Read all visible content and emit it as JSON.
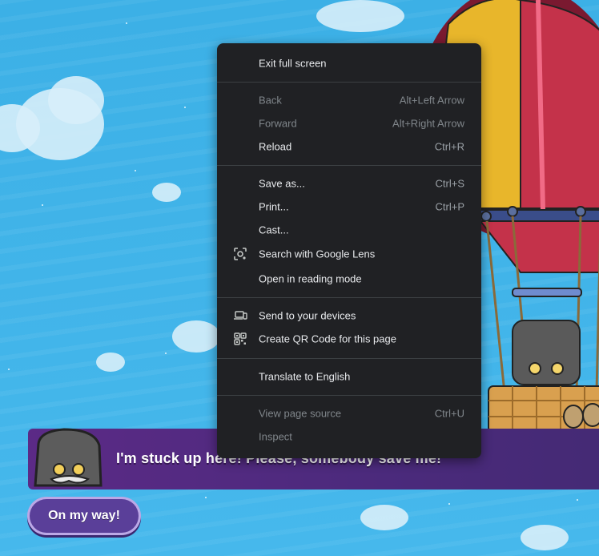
{
  "game": {
    "dialog_text": "I'm stuck up here! Please, somebody save me!",
    "cta_label": "On my way!"
  },
  "context_menu": {
    "items": [
      {
        "label": "Exit full screen",
        "shortcut": "",
        "enabled": true
      },
      {
        "label": "Back",
        "shortcut": "Alt+Left Arrow",
        "enabled": false
      },
      {
        "label": "Forward",
        "shortcut": "Alt+Right Arrow",
        "enabled": false
      },
      {
        "label": "Reload",
        "shortcut": "Ctrl+R",
        "enabled": true
      },
      {
        "label": "Save as...",
        "shortcut": "Ctrl+S",
        "enabled": true
      },
      {
        "label": "Print...",
        "shortcut": "Ctrl+P",
        "enabled": true
      },
      {
        "label": "Cast...",
        "shortcut": "",
        "enabled": true
      },
      {
        "label": "Search with Google Lens",
        "shortcut": "",
        "enabled": true,
        "icon": "google-lens-icon"
      },
      {
        "label": "Open in reading mode",
        "shortcut": "",
        "enabled": true
      },
      {
        "label": "Send to your devices",
        "shortcut": "",
        "enabled": true,
        "icon": "devices-icon"
      },
      {
        "label": "Create QR Code for this page",
        "shortcut": "",
        "enabled": true,
        "icon": "qr-code-icon"
      },
      {
        "label": "Translate to English",
        "shortcut": "",
        "enabled": true
      },
      {
        "label": "View page source",
        "shortcut": "Ctrl+U",
        "enabled": false
      },
      {
        "label": "Inspect",
        "shortcut": "",
        "enabled": false
      }
    ]
  },
  "colors": {
    "menu_bg": "#202124",
    "menu_text": "#e8eaed",
    "menu_disabled": "#80868b",
    "dialog_bg": "#4b2a7c",
    "sky": "#3fb2e8"
  }
}
